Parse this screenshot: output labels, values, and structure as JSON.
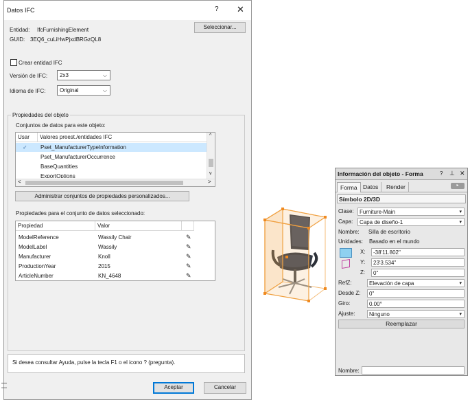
{
  "ifc_dialog": {
    "title": "Datos IFC",
    "help_glyph": "?",
    "close_glyph": "✕",
    "entity_label": "Entidad:",
    "entity_value": "IfcFurnishingElement",
    "guid_label": "GUID:",
    "guid_value": "3EQ6_cuLiHwPjxdBRGzQL8",
    "select_button": "Seleccionar...",
    "create_entity_label": "Crear entidad IFC",
    "ifc_version_label": "Versión de IFC:",
    "ifc_version_value": "2x3",
    "ifc_language_label": "Idioma de IFC:",
    "ifc_language_value": "Original",
    "object_props_group": "Propiedades del objeto",
    "datasets_label": "Conjuntos de datos para este objeto:",
    "datasets_table": {
      "columns": [
        "Usar",
        "Valores preest./entidades IFC"
      ],
      "rows": [
        {
          "check": "✓",
          "name": "Pset_ManufacturerTypeInformation",
          "selected": true
        },
        {
          "check": "",
          "name": "Pset_ManufacturerOccurrence",
          "selected": false
        },
        {
          "check": "",
          "name": "BaseQuantities",
          "selected": false
        },
        {
          "check": "",
          "name": "ExportOptions",
          "selected": false
        }
      ]
    },
    "manage_button": "Administrar conjuntos de propiedades personalizados...",
    "dataset_props_label": "Propiedades para el conjunto de datos seleccionado:",
    "props_table": {
      "columns": [
        "Propiedad",
        "Valor"
      ],
      "rows": [
        {
          "property": "ModelReference",
          "value": "Wassily Chair"
        },
        {
          "property": "ModelLabel",
          "value": "Wassily"
        },
        {
          "property": "Manufacturer",
          "value": "Knoll"
        },
        {
          "property": "ProductionYear",
          "value": "2015"
        },
        {
          "property": "ArticleNumber",
          "value": "KN_4648"
        }
      ]
    },
    "help_text": "Si desea consultar Ayuda, pulse la tecla F1 o el icono ? (pregunta).",
    "ok_button": "Aceptar",
    "cancel_button": "Cancelar"
  },
  "object_info": {
    "title": "Información del objeto - Forma",
    "tabs": [
      "Forma",
      "Datos",
      "Render"
    ],
    "symbol_header": "Símbolo 2D/3D",
    "class_label": "Clase:",
    "class_value": "Furniture-Main",
    "layer_label": "Capa:",
    "layer_value": "Capa de diseño-1",
    "name_label": "Nombre:",
    "name_value": "Silla de escritorio",
    "units_label": "Unidades:",
    "units_value": "Basado en el mundo",
    "x_label": "X:",
    "x_value": "-38'11.802\"",
    "y_label": "Y:",
    "y_value": "23'3.534\"",
    "z_label": "Z:",
    "z_value": "0\"",
    "refz_label": "RefZ:",
    "refz_value": "Elevación de capa",
    "from_z_label": "Desde Z:",
    "from_z_value": "0\"",
    "rotation_label": "Giro:",
    "rotation_value": "0.00°",
    "fit_label": "Ajuste:",
    "fit_value": "Ninguno",
    "replace_button": "Reemplazar",
    "footer_name_label": "Nombre:",
    "footer_name_value": ""
  },
  "colors": {
    "selection": "#cce8ff",
    "accent": "#0078d7",
    "bbox_orange": "#f0a040",
    "chair_body": "#3a3f4a"
  }
}
